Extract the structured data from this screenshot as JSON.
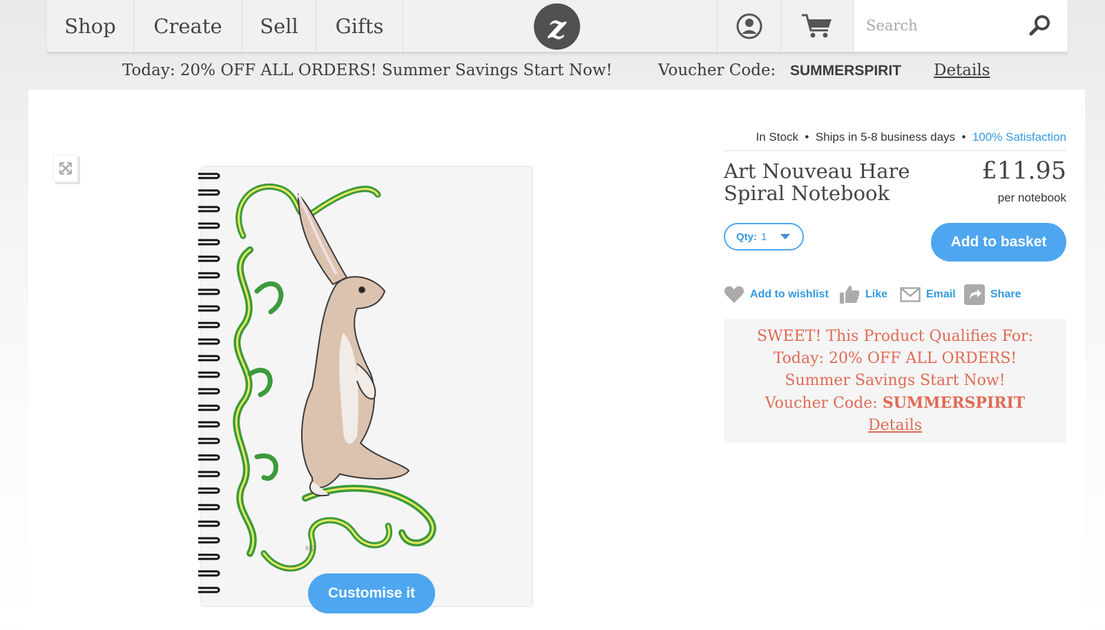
{
  "nav": {
    "items": [
      "Shop",
      "Create",
      "Sell",
      "Gifts"
    ],
    "logo_letter": "z",
    "search_placeholder": "Search"
  },
  "promo": {
    "text": "Today: 20% OFF ALL ORDERS! Summer Savings Start Now!",
    "voucher_label": "Voucher Code:",
    "voucher_code": "SUMMERSPIRIT",
    "details": "Details"
  },
  "product": {
    "stock": "In Stock",
    "shipping": "Ships in 5-8 business days",
    "satisfaction": "100% Satisfaction",
    "title": "Art Nouveau Hare Spiral Notebook",
    "price": "£11.95",
    "per_unit": "per notebook",
    "qty_label": "Qty:",
    "qty_value": "1",
    "add_to_basket": "Add to basket",
    "customise": "Customise it"
  },
  "actions": {
    "wishlist": "Add to wishlist",
    "like": "Like",
    "email": "Email",
    "share": "Share"
  },
  "offer": {
    "line1": "SWEET! This Product Qualifies For:",
    "line2": "Today: 20% OFF ALL ORDERS!",
    "line3": "Summer Savings Start Now!",
    "voucher_label": "Voucher Code:",
    "voucher_code": "SUMMERSPIRIT",
    "details": "Details"
  },
  "colors": {
    "accent": "#4da6ef",
    "link": "#3399e0",
    "offer_text": "#e06a54"
  }
}
